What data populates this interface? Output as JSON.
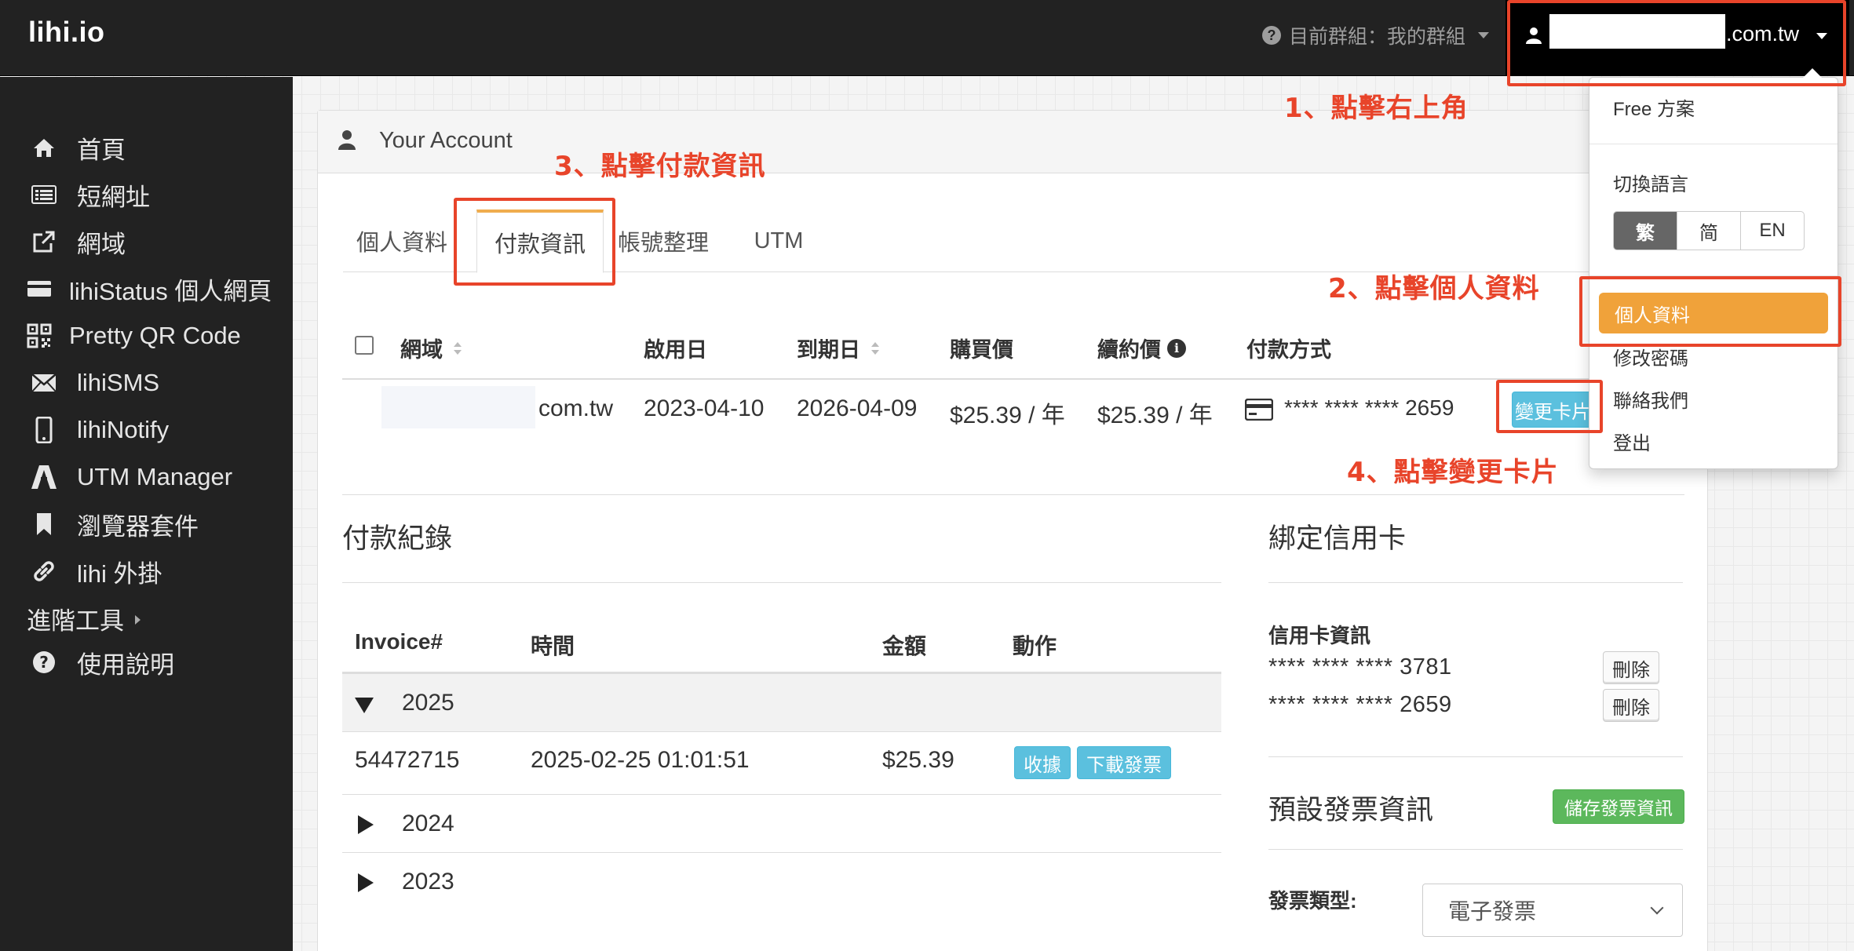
{
  "brand": "lihi.io",
  "topbar": {
    "group_label": "目前群組：我的群組",
    "user_email_suffix": "o.com.tw"
  },
  "sidebar": {
    "items": [
      {
        "label": "首頁",
        "icon": "home-icon"
      },
      {
        "label": "短網址",
        "icon": "list-icon"
      },
      {
        "label": "網域",
        "icon": "external-link-icon"
      },
      {
        "label": "lihiStatus 個人網頁",
        "icon": "card-icon"
      },
      {
        "label": "Pretty QR Code",
        "icon": "qrcode-icon"
      },
      {
        "label": "lihiSMS",
        "icon": "envelope-icon"
      },
      {
        "label": "lihiNotify",
        "icon": "mobile-icon"
      },
      {
        "label": "UTM Manager",
        "icon": "utm-icon"
      },
      {
        "label": "瀏覽器套件",
        "icon": "bookmark-icon"
      },
      {
        "label": "lihi 外掛",
        "icon": "link-icon"
      },
      {
        "label": "進階工具",
        "icon": ""
      },
      {
        "label": "使用說明",
        "icon": "question-circle-icon"
      }
    ]
  },
  "panel": {
    "title": "Your Account",
    "tabs": [
      "個人資料",
      "付款資訊",
      "帳號整理",
      "UTM"
    ],
    "active_tab": "付款資訊"
  },
  "domain_table": {
    "headers": [
      "網域",
      "啟用日",
      "到期日",
      "購買價",
      "續約價",
      "付款方式"
    ],
    "row": {
      "domain_suffix": "com.tw",
      "start": "2023-04-10",
      "expiry": "2026-04-09",
      "price": "$25.39 / 年",
      "renewal": "$25.39 / 年",
      "card": "**** **** **** 2659",
      "change_card_button": "變更卡片"
    }
  },
  "payments": {
    "title": "付款紀錄",
    "headers": [
      "Invoice#",
      "時間",
      "金額",
      "動作"
    ],
    "years": [
      "2025",
      "2024",
      "2023"
    ],
    "rows": [
      {
        "invoice": "54472715",
        "time": "2025-02-25 01:01:51",
        "amount": "$25.39",
        "receipt_button": "收據",
        "download_button": "下載發票"
      }
    ]
  },
  "cards": {
    "title": "綁定信用卡",
    "subtitle": "信用卡資訊",
    "list": [
      {
        "number": "**** **** **** 3781",
        "delete": "刪除"
      },
      {
        "number": "**** **** **** 2659",
        "delete": "刪除"
      }
    ]
  },
  "invoice_settings": {
    "title": "預設發票資訊",
    "save_button": "儲存發票資訊",
    "type_label": "發票類型:",
    "type_value": "電子發票"
  },
  "dropdown": {
    "plan": "Free 方案",
    "language_label": "切換語言",
    "languages": [
      "繁",
      "简",
      "EN"
    ],
    "active_language": "繁",
    "profile": "個人資料",
    "change_password": "修改密碼",
    "contact": "聯絡我們",
    "logout": "登出"
  },
  "annotations": {
    "step1": "1、點擊右上角",
    "step2": "2、點擊個人資料",
    "step3": "3、點擊付款資訊",
    "step4": "4、點擊變更卡片"
  },
  "colors": {
    "navbar": "#222222",
    "accent_orange": "#f0a23a",
    "info_button": "#5bc0de",
    "success_button": "#5cb85c",
    "annotation_red": "#e8442a"
  }
}
